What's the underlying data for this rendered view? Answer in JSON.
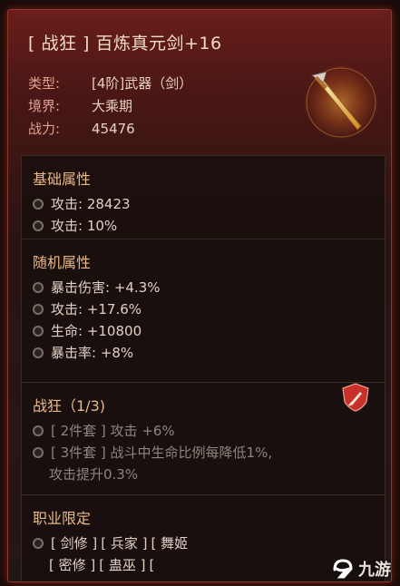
{
  "item": {
    "title": "[ 战狂 ] 百炼真元剑+16",
    "type_label": "类型:",
    "type_value": "[4阶]武器（剑）",
    "realm_label": "境界:",
    "realm_value": "大乘期",
    "power_label": "战力:",
    "power_value": "45476"
  },
  "base_attrs": {
    "title": "基础属性",
    "items": [
      "攻击: 28423",
      "攻击: 10%"
    ]
  },
  "random_attrs": {
    "title": "随机属性",
    "items": [
      "暴击伤害: +4.3%",
      "攻击: +17.6%",
      "生命: +10800",
      "暴击率: +8%"
    ]
  },
  "set_bonus": {
    "title": "战狂（1/3)",
    "items": [
      "[ 2件套 ] 攻击 +6%",
      "[ 3件套 ] 战斗中生命比例每降低1%,",
      "攻击提升0.3%"
    ]
  },
  "class_limit": {
    "title": "职业限定",
    "row1": [
      "[ 剑修 ]",
      "[ 兵家 ]",
      "[ 舞姬"
    ],
    "row2": [
      "[ 密修 ]",
      "[ 蛊巫 ]",
      "["
    ]
  },
  "watermark": {
    "text": "九游"
  },
  "colors": {
    "accent": "#e8b888",
    "frame": "#8a3a30",
    "badge": "#c8302a"
  }
}
